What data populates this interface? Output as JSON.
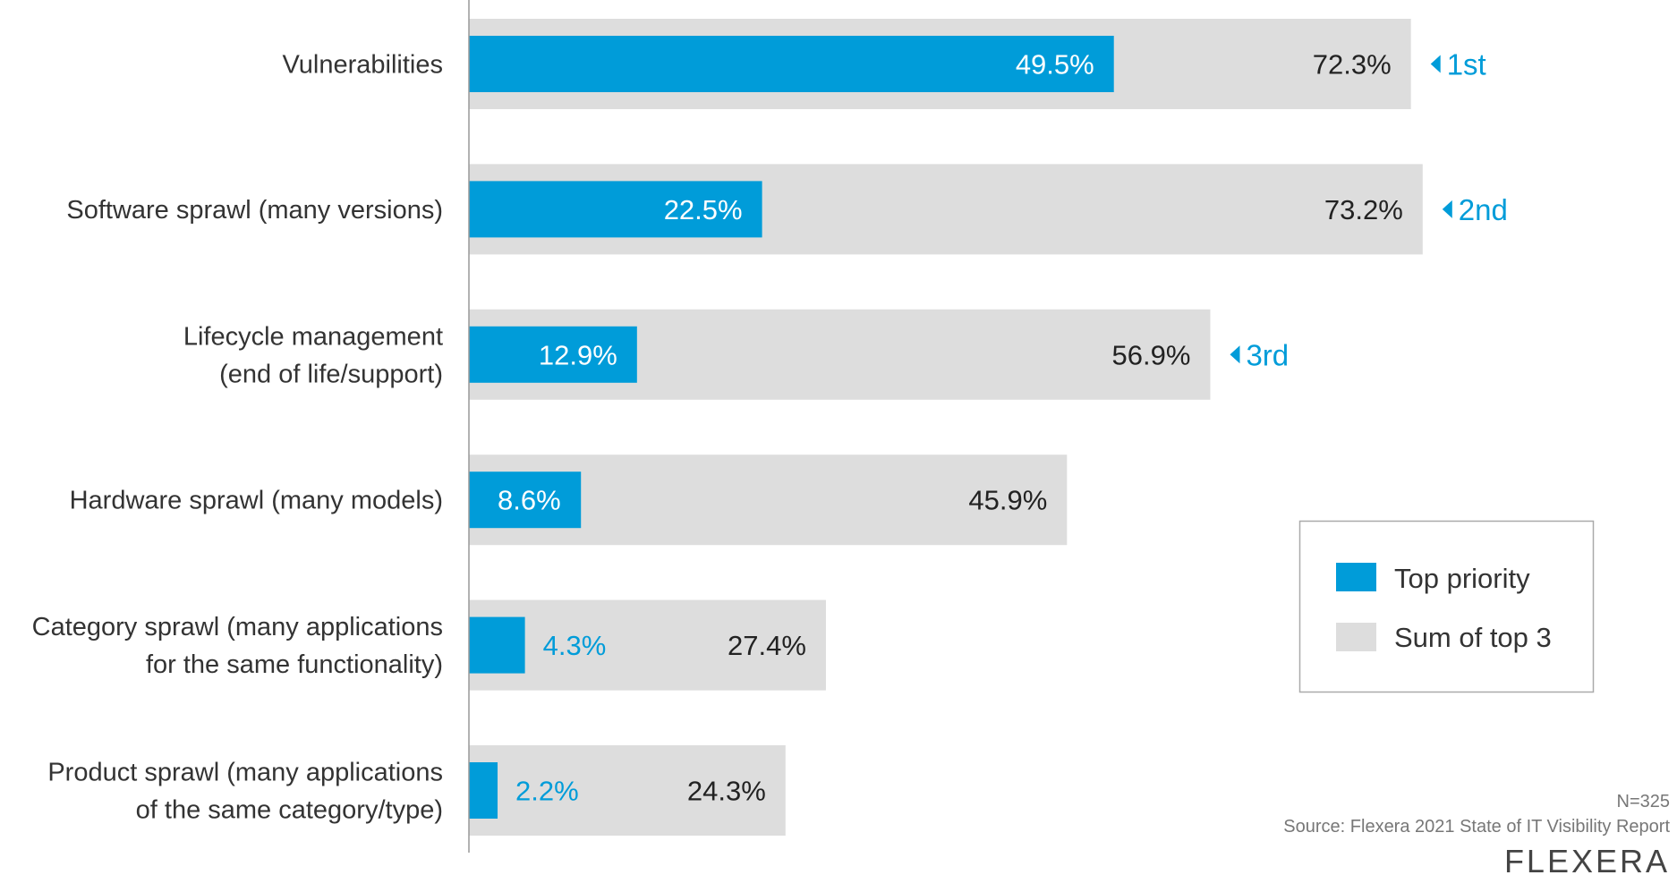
{
  "chart_data": {
    "type": "bar",
    "orientation": "horizontal",
    "title": "",
    "xlabel": "",
    "ylabel": "",
    "xlim": [
      0,
      100
    ],
    "grid": false,
    "categories": [
      [
        "Vulnerabilities"
      ],
      [
        "Software sprawl (many versions)"
      ],
      [
        "Lifecycle management",
        "(end of life/support)"
      ],
      [
        "Hardware sprawl (many models)"
      ],
      [
        "Category sprawl (many applications",
        "for the same functionality)"
      ],
      [
        "Product sprawl (many applications",
        "of the same category/type)"
      ]
    ],
    "series": [
      {
        "name": "Top priority",
        "color": "#009cd9",
        "values": [
          49.5,
          22.5,
          12.9,
          8.6,
          4.3,
          2.2
        ]
      },
      {
        "name": "Sum of top 3",
        "color": "#dddddd",
        "values": [
          72.3,
          73.2,
          56.9,
          45.9,
          27.4,
          24.3
        ]
      }
    ],
    "value_labels": {
      "top_priority": [
        "49.5%",
        "22.5%",
        "12.9%",
        "8.6%",
        "4.3%",
        "2.2%"
      ],
      "sum_of_top_3": [
        "72.3%",
        "73.2%",
        "56.9%",
        "45.9%",
        "27.4%",
        "24.3%"
      ]
    },
    "annotations": [
      {
        "row": 0,
        "text": "1st"
      },
      {
        "row": 1,
        "text": "2nd"
      },
      {
        "row": 2,
        "text": "3rd"
      }
    ],
    "legend": {
      "placement": "bottom-right",
      "items": [
        {
          "label": "Top priority",
          "color": "#009cd9"
        },
        {
          "label": "Sum of top 3",
          "color": "#dddddd"
        }
      ]
    }
  },
  "footer": {
    "n": "N=325",
    "source": "Source: Flexera 2021 State of IT Visibility Report",
    "logo": "FLEXERA"
  },
  "colors": {
    "accent": "#009cd9",
    "bar_bg": "#dddddd",
    "axis": "#999999",
    "legend_border": "#aaaaaa"
  }
}
